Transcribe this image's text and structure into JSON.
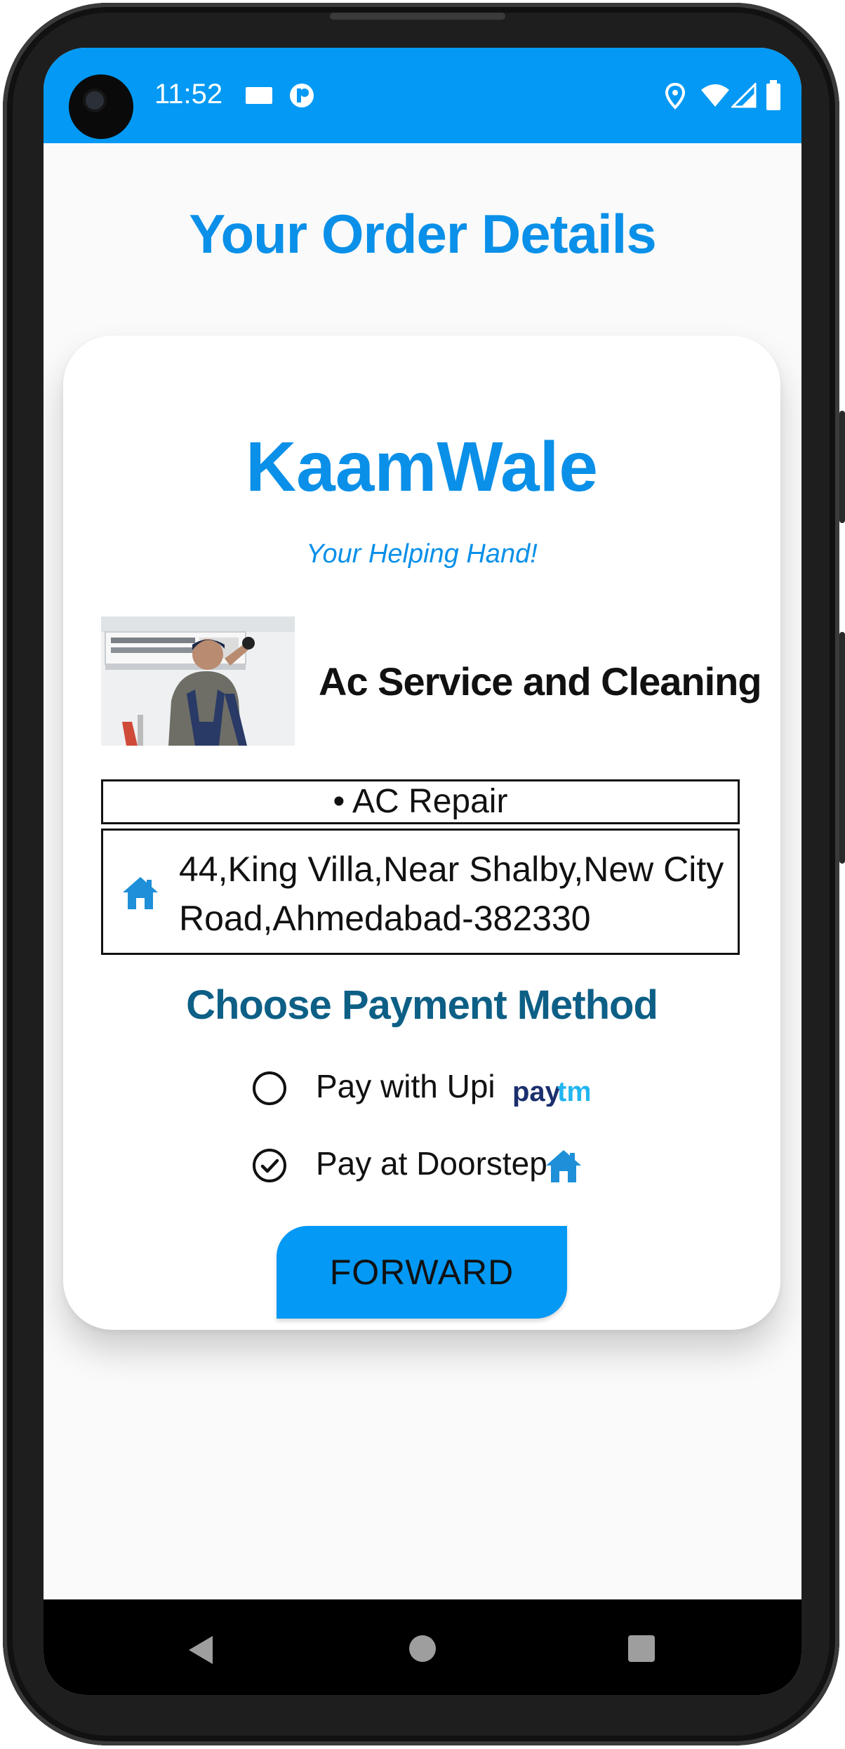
{
  "status_bar": {
    "time": "11:52",
    "left_icons": [
      "notification-card-icon",
      "app-notification-icon"
    ],
    "right_icons": [
      "location-icon",
      "wifi-icon",
      "signal-icon",
      "battery-icon"
    ]
  },
  "page": {
    "title": "Your Order Details"
  },
  "card": {
    "brand": "KaamWale",
    "tagline": "Your Helping Hand!",
    "service_image": "ac-technician-photo",
    "service_name": "Ac Service and Cleaning",
    "service_item": "• AC Repair",
    "address_icon": "home-icon",
    "address": "44,King Villa,Near Shalby,New City Road,Ahmedabad-382330",
    "payment_heading": "Choose Payment Method",
    "payment_options": [
      {
        "label": "Pay with Upi",
        "selected": false,
        "icon": "paytm-logo"
      },
      {
        "label": "Pay at Doorstep",
        "selected": true,
        "icon": "home-icon"
      }
    ],
    "forward_label": "FORWARD"
  },
  "colors": {
    "accent": "#0399f4",
    "title": "#0a90e8",
    "heading": "#0d5f86"
  },
  "nav": [
    "back-icon",
    "home-circle-icon",
    "recents-icon"
  ]
}
